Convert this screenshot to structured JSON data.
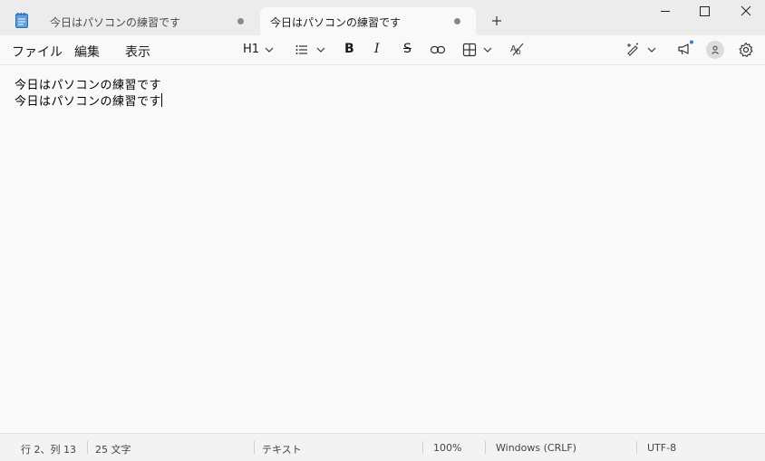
{
  "tabs": [
    {
      "title": "今日はパソコンの練習です",
      "active": false
    },
    {
      "title": "今日はパソコンの練習です",
      "active": true
    }
  ],
  "icons": {
    "app": "notepad-icon",
    "new_tab": "plus-icon",
    "minimize": "minimize-icon",
    "maximize": "maximize-icon",
    "close": "close-icon"
  },
  "menu": {
    "file": "ファイル",
    "edit": "編集",
    "view": "表示"
  },
  "toolbar": {
    "heading": "H1",
    "bold": "B",
    "italic": "I",
    "strike": "S"
  },
  "editor": {
    "lines": [
      "今日はパソコンの練習です",
      "今日はパソコンの練習です"
    ]
  },
  "status": {
    "position": "行 2、列 13",
    "count": "25 文字",
    "format": "テキスト",
    "zoom": "100%",
    "line_ending": "Windows (CRLF)",
    "encoding": "UTF-8"
  },
  "colors": {
    "notification_dot": "#2b7cd3"
  }
}
